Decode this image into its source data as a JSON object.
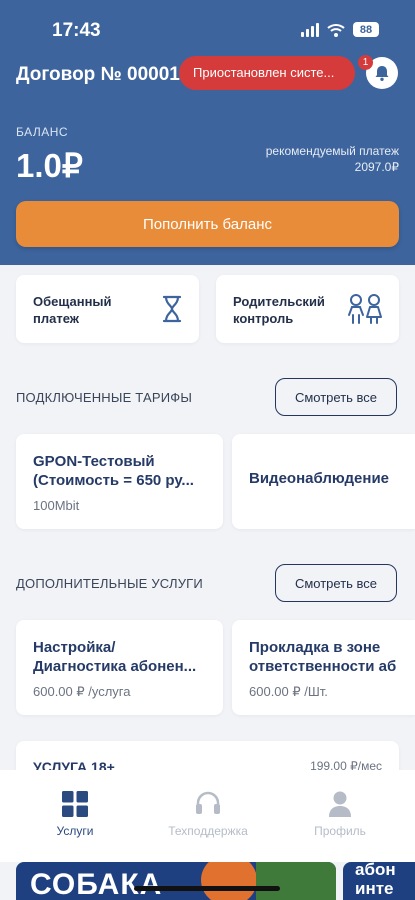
{
  "status_bar": {
    "time": "17:43",
    "battery": "88"
  },
  "header": {
    "contract_title": "Договор № 00001",
    "status_pill": "Приостановлен систе...",
    "notification_count": "1",
    "balance_label": "БАЛАНС",
    "balance_value": "1.0₽",
    "recommended_label": "рекомендуемый платеж",
    "recommended_value": "2097.0₽",
    "topup_button": "Пополнить баланс"
  },
  "quick_actions": [
    {
      "label": "Обещанный платеж",
      "icon": "hourglass-icon"
    },
    {
      "label": "Родительский контроль",
      "icon": "children-icon"
    }
  ],
  "tariffs": {
    "title": "ПОДКЛЮЧЕННЫЕ ТАРИФЫ",
    "see_all": "Смотреть все",
    "items": [
      {
        "name_line1": "GPON-Тестовый",
        "name_line2": "(Стоимость = 650 ру...",
        "sub": "100Mbit"
      },
      {
        "name_line1": "Видеонаблюдение"
      }
    ]
  },
  "extra_services": {
    "title": "ДОПОЛНИТЕЛЬНЫЕ УСЛУГИ",
    "see_all": "Смотреть все",
    "items": [
      {
        "name_line1": "Настройка/",
        "name_line2": "Диагностика абонен...",
        "price": "600.00 ₽ /услуга"
      },
      {
        "name_line1": "Прокладка в зоне",
        "name_line2": "ответственности аб",
        "price": "600.00 ₽ /Шт."
      }
    ],
    "partial": {
      "name": "УСЛУГА 18+",
      "price": "199.00 ₽/мес"
    }
  },
  "bottom_nav": [
    {
      "label": "Услуги",
      "icon": "grid-icon",
      "active": true
    },
    {
      "label": "Техподдержка",
      "icon": "headset-icon",
      "active": false
    },
    {
      "label": "Профиль",
      "icon": "person-icon",
      "active": false
    }
  ],
  "promo": {
    "left_line1": "СОБАКА",
    "right_line1": "абон",
    "right_line2": "инте"
  },
  "colors": {
    "header": "#3d649d",
    "accent": "#e88c3a",
    "alert": "#d63b3b",
    "active_tab": "#2b4a80",
    "inactive_tab": "#b5bcc7"
  }
}
